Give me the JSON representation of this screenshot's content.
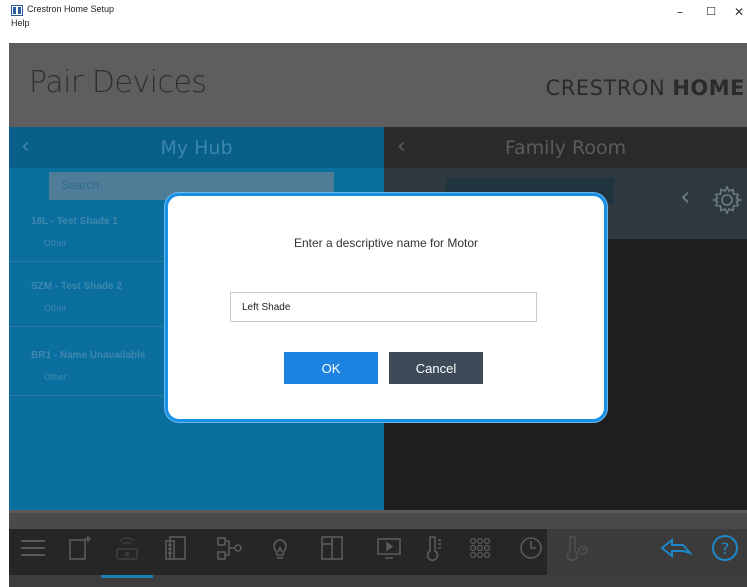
{
  "window": {
    "title": "Crestron Home Setup",
    "menu": [
      "Help"
    ],
    "controls": {
      "minimize": "–",
      "maximize": "☐",
      "close": "✕"
    }
  },
  "header": {
    "page_title": "Pair Devices",
    "brand_light": "CRESTRON ",
    "brand_bold": "HOME"
  },
  "hub_panel": {
    "back_glyph": "‹",
    "title": "My Hub",
    "search_placeholder": "Search",
    "devices": [
      {
        "name": "18L - Test Shade 1",
        "type": "Other"
      },
      {
        "name": "SZM - Test Shade 2",
        "type": "Other"
      },
      {
        "name": "BR1 - Name Unavailable",
        "type": "Other"
      }
    ]
  },
  "room_panel": {
    "back_glyph": "‹",
    "title": "Family Room",
    "chevron_glyph": "‹"
  },
  "toolbar": {
    "icons": [
      "menu-icon",
      "add-room-icon",
      "pair-devices-icon",
      "shades-icon",
      "scenes-icon",
      "lights-icon",
      "door-icon",
      "media-icon",
      "thermostat-icon",
      "keypad-icon",
      "schedule-icon",
      "temperature-sensor-icon"
    ],
    "active": "pair-devices-icon",
    "back_icon": "back-arrow-icon",
    "help_glyph": "?"
  },
  "dialog": {
    "prompt": "Enter a descriptive name for Motor",
    "name_value": "Left Shade",
    "ok_label": "OK",
    "cancel_label": "Cancel"
  },
  "colors": {
    "hub_blue": "#0a6e9e",
    "dialog_border": "#1890e4",
    "ok_button": "#1c83e2",
    "cancel_button": "#3d4b59"
  }
}
